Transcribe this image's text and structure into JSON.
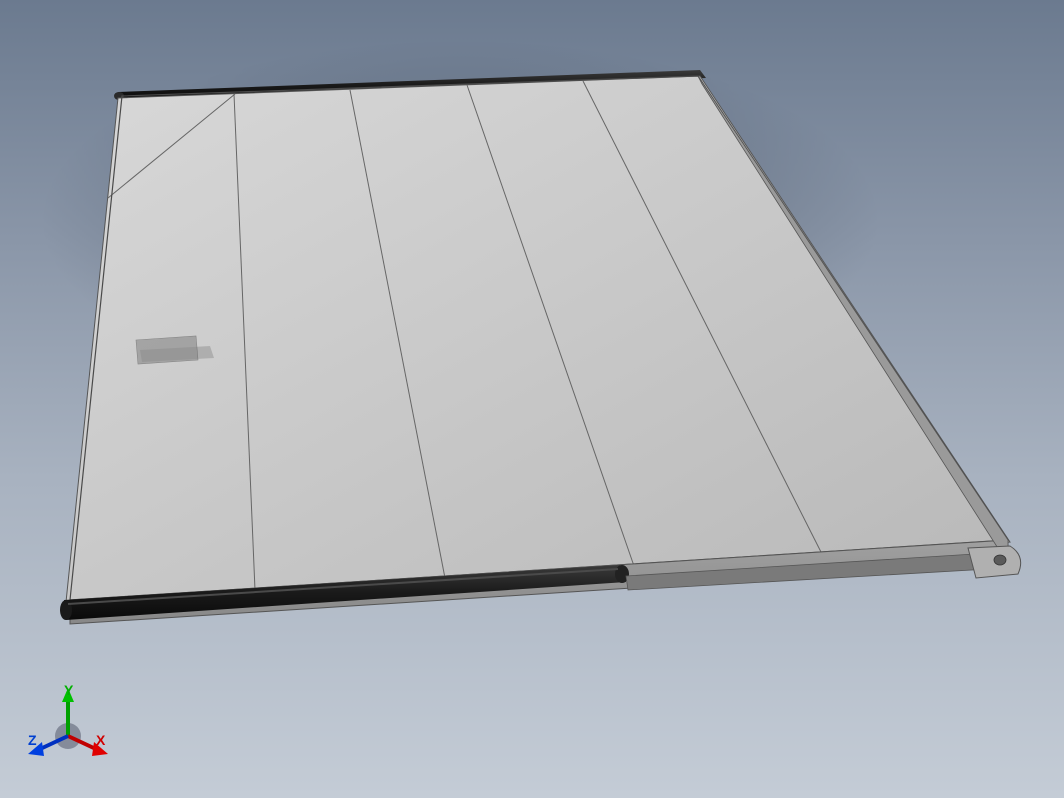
{
  "scene": {
    "description": "3D CAD isometric view of a flat panel assembly with segmented top surface, black side rails, and mounting tabs",
    "background_gradient": [
      "#6b7a8f",
      "#c4ccd6"
    ],
    "shadow": true
  },
  "model": {
    "type": "panel-assembly",
    "top_segments": 5,
    "rails": {
      "material_color": "#1a1a1a",
      "count": 2
    },
    "panel": {
      "material_color": "#c8c8c8",
      "edge_color": "#555555"
    },
    "mounting_tab": {
      "position": "front-right",
      "has_hole": true
    }
  },
  "axis_triad": {
    "x": {
      "label": "X",
      "color": "#d00000"
    },
    "y": {
      "label": "Y",
      "color": "#00b000"
    },
    "z": {
      "label": "Z",
      "color": "#0040d0"
    },
    "origin_color": "#808080"
  }
}
